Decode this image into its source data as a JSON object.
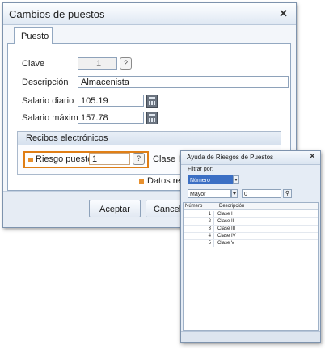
{
  "dialog": {
    "title": "Cambios de puestos",
    "close_icon": "close-icon",
    "tab": "Puesto",
    "fields": {
      "clave_label": "Clave",
      "clave_value": "1",
      "descripcion_label": "Descripción",
      "descripcion_value": "Almacenista",
      "salario_diario_label": "Salario diario",
      "salario_diario_value": "105.19",
      "salario_maximo_label": "Salario máximo",
      "salario_maximo_value": "157.78"
    },
    "group": {
      "title": "Recibos electrónicos",
      "riesgo_label": "Riesgo puesto",
      "riesgo_value": "1",
      "riesgo_desc": "Clase I"
    },
    "required_note": "Datos req",
    "buttons": {
      "accept": "Aceptar",
      "cancel": "Cancelar"
    },
    "accent_color": "#e07f16"
  },
  "help_window": {
    "title": "Ayuda de Riesgos de Puestos",
    "filter_label": "Filtrar por:",
    "filter_field": "Número",
    "operator": "Mayor",
    "filter_value": "0",
    "columns": [
      "Número",
      "Descripción"
    ],
    "rows": [
      {
        "num": "1",
        "desc": "Clase I"
      },
      {
        "num": "2",
        "desc": "Clase II"
      },
      {
        "num": "3",
        "desc": "Clase III"
      },
      {
        "num": "4",
        "desc": "Clase IV"
      },
      {
        "num": "5",
        "desc": "Clase V"
      }
    ],
    "selected_color": "#3b6fc4"
  }
}
